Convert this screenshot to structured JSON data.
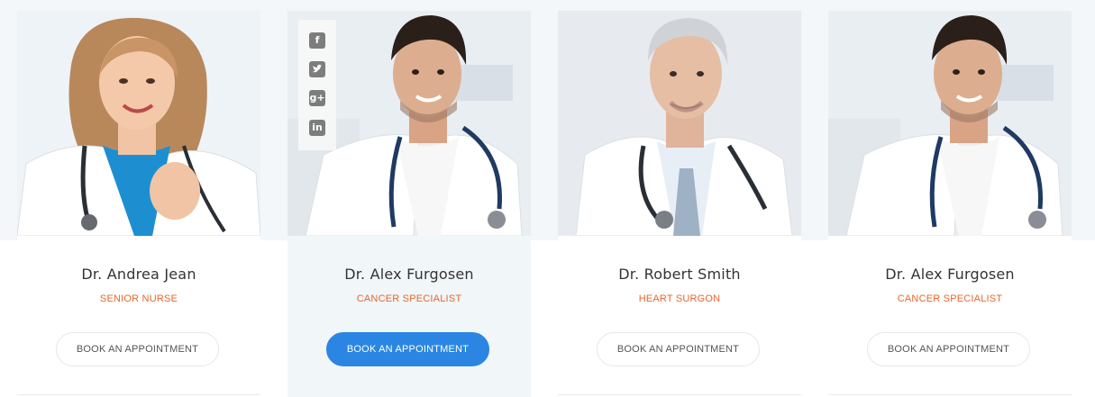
{
  "doctors": [
    {
      "name": "Dr. Andrea Jean",
      "role": "SENIOR NURSE",
      "button": "BOOK AN APPOINTMENT"
    },
    {
      "name": "Dr. Alex Furgosen",
      "role": "CANCER SPECIALIST",
      "button": "BOOK AN APPOINTMENT"
    },
    {
      "name": "Dr. Robert Smith",
      "role": "HEART SURGON",
      "button": "BOOK AN APPOINTMENT"
    },
    {
      "name": "Dr. Alex Furgosen",
      "role": "CANCER SPECIALIST",
      "button": "BOOK AN APPOINTMENT"
    }
  ],
  "social": {
    "facebook": "f",
    "twitter-icon": "twitter-bird-icon",
    "google": "g+",
    "linkedin": "in"
  },
  "colors": {
    "accent": "#2a86e2",
    "role": "#e8652b",
    "band": "#f3f7fa"
  }
}
